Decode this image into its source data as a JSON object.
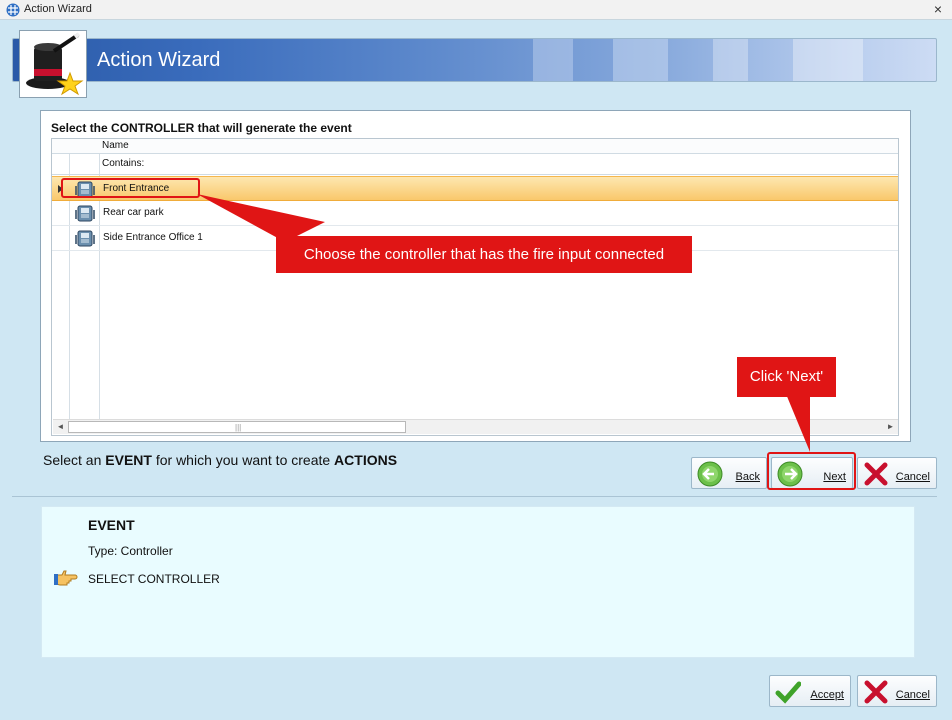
{
  "window": {
    "title": "Action Wizard",
    "close_glyph": "×"
  },
  "banner": {
    "title": "Action Wizard",
    "logo_icon": "magic-hat-wand-star-icon"
  },
  "grid": {
    "heading": "Select the CONTROLLER that will generate the event",
    "column_name": "Name",
    "filter_label": "Contains:",
    "rows": [
      {
        "label": "Front Entrance",
        "selected": true
      },
      {
        "label": "Rear car park",
        "selected": false
      },
      {
        "label": "Side Entrance Office 1",
        "selected": false
      }
    ],
    "scroll_left": "◄",
    "scroll_right": "►",
    "scroll_grip": "|||"
  },
  "callouts": {
    "controller": "Choose the controller that has the fire input connected",
    "next": "Click 'Next'"
  },
  "instruction": {
    "pre": "Select an ",
    "event": "EVENT",
    "mid": " for which you want to create ",
    "actions": "ACTIONS"
  },
  "nav_buttons": {
    "back": "Back",
    "next": "Next",
    "cancel": "Cancel"
  },
  "event_panel": {
    "title": "EVENT",
    "type": "Type: Controller",
    "step": "SELECT CONTROLLER"
  },
  "footer_buttons": {
    "accept": "Accept",
    "cancel": "Cancel"
  },
  "colors": {
    "callout_red": "#e01515",
    "selection_orange": "#f9c86b",
    "window_bg": "#cfe7f3"
  }
}
